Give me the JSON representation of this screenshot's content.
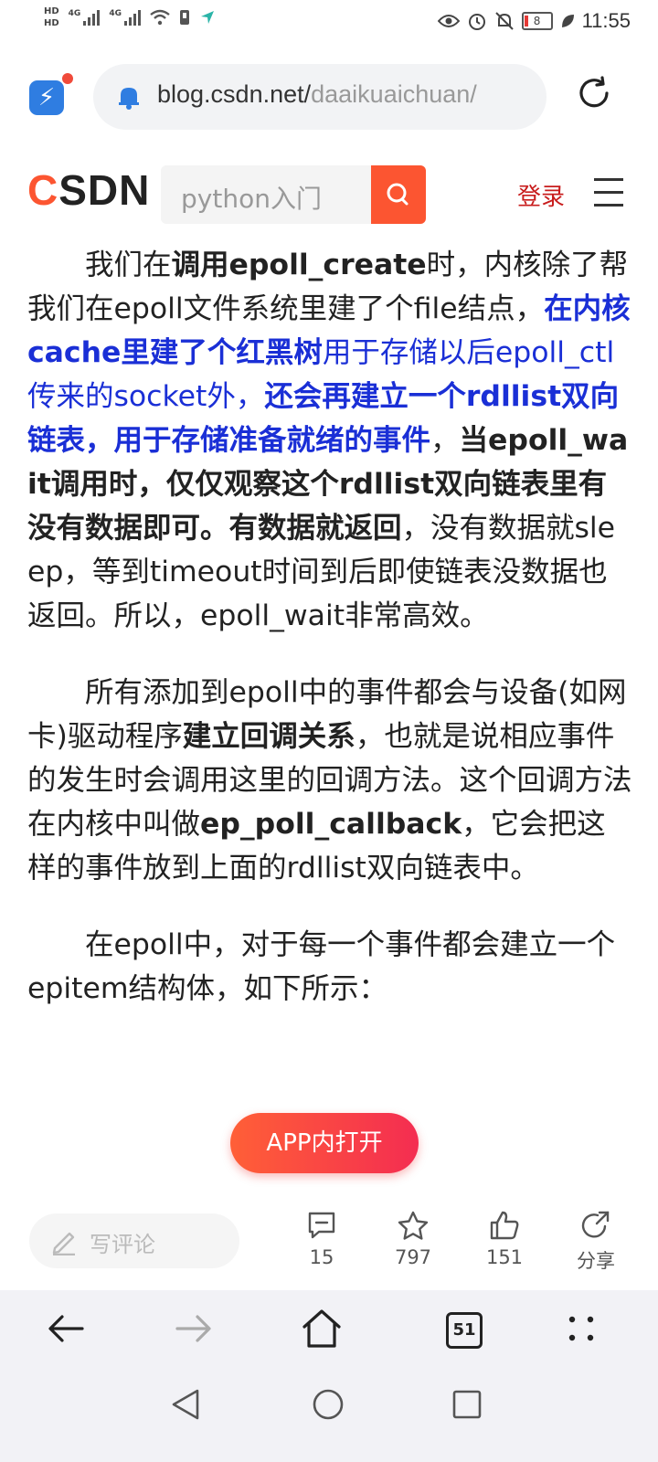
{
  "status_bar": {
    "hd1": "HD",
    "hd2": "HD",
    "net1": "4G",
    "net2": "4G",
    "battery": "8",
    "time": "11:55"
  },
  "browser": {
    "url_host": "blog.csdn.net/",
    "url_path": "daaikuaichuan/"
  },
  "csdn": {
    "logo_c": "C",
    "logo_rest": "SDN",
    "search_placeholder": "python入门",
    "login": "登录"
  },
  "article": {
    "p1": [
      {
        "t": "我们在",
        "s": ""
      },
      {
        "t": "调用epoll_create",
        "s": "b"
      },
      {
        "t": "时，内核除了帮我们在epoll文件系统里建了个file结点，",
        "s": ""
      },
      {
        "t": "在内核cache里建了个红黑树",
        "s": "bb"
      },
      {
        "t": "用于存储以后epoll_ctl传来的socket外，",
        "s": "blue"
      },
      {
        "t": "还会再建立一个rdllist双向链表，用于存储准备就绪的事件",
        "s": "bb"
      },
      {
        "t": "，",
        "s": ""
      },
      {
        "t": "当epoll_wait调用时，仅仅观察这个rdllist双向链表里有没有数据即可。有数据就返回",
        "s": "b"
      },
      {
        "t": "，没有数据就sleep，等到timeout时间到后即使链表没数据也返回。所以，epoll_wait非常高效。",
        "s": ""
      }
    ],
    "p2": [
      {
        "t": "所有添加到epoll中的事件都会与设备(如网卡)驱动程序",
        "s": ""
      },
      {
        "t": "建立回调关系",
        "s": "b"
      },
      {
        "t": "，也就是说相应事件的发生时会调用这里的回调方法。这个回调方法在内核中叫做",
        "s": ""
      },
      {
        "t": "ep_poll_callback",
        "s": "b"
      },
      {
        "t": "，它会把这样的事件放到上面的rdllist双向链表中。",
        "s": ""
      }
    ],
    "p3": [
      {
        "t": "在epoll中，对于每一个事件都会建立一个epitem结构体，如下所示：",
        "s": ""
      }
    ]
  },
  "app_button": "APP内打开",
  "action_bar": {
    "comment_placeholder": "写评论",
    "comments": "15",
    "favorites": "797",
    "likes": "151",
    "share": "分享"
  },
  "browser_nav": {
    "tab_count": "51"
  }
}
